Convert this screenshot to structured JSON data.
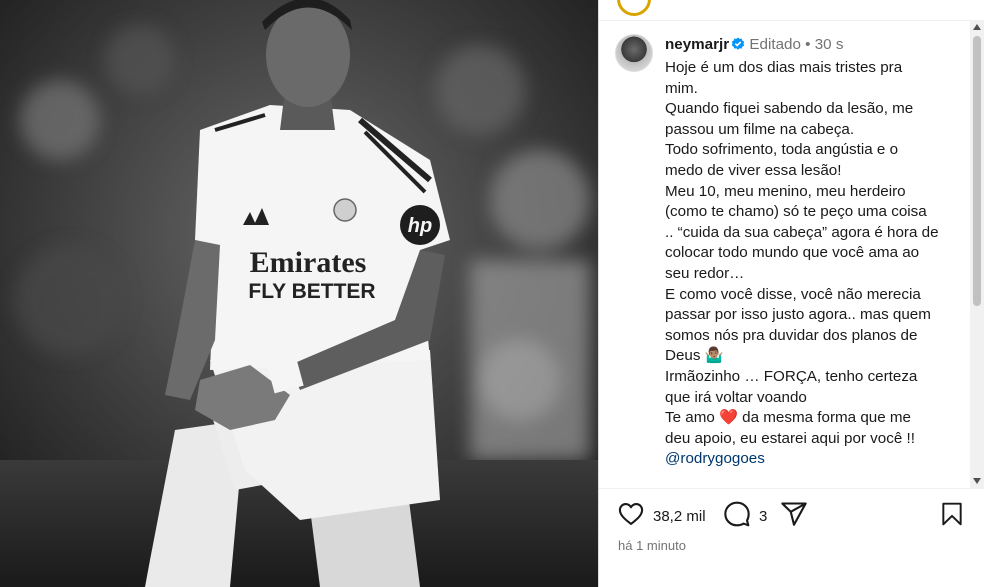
{
  "post": {
    "username": "neymarjr",
    "edited": "Editado",
    "separator": "•",
    "age": "30 s",
    "caption_lines": [
      "Hoje é um dos dias mais tristes pra",
      "mim.",
      "Quando fiquei sabendo da lesão, me",
      "passou um filme na cabeça.",
      "Todo sofrimento, toda angústia e o",
      "medo de viver essa lesão!",
      "Meu 10, meu menino, meu herdeiro",
      "(como te chamo) só te peço uma coisa",
      ".. “cuida da sua cabeça” agora é hora de",
      "colocar todo mundo que você ama ao",
      "seu redor…",
      "E como você disse, você não merecia",
      "passar por isso justo agora.. mas quem",
      "somos nós pra duvidar dos planos de",
      "Deus 🤷🏽‍♂️",
      "Irmãozinho … FORÇA, tenho certeza",
      "que irá voltar voando",
      "Te amo ❤️ da mesma forma que me",
      "deu apoio, eu estarei aqui por você !!"
    ],
    "mention": "@rodrygogoes",
    "likes": "38,2 mil",
    "comments": "3",
    "timestamp": "há 1 minuto"
  },
  "photo": {
    "jersey_sponsor": "Emirates",
    "jersey_sponsor_line2": "FLY BETTER",
    "sleeve_logo": "hp"
  },
  "icons": {
    "like": "heart-icon",
    "comment": "comment-icon",
    "share": "share-icon",
    "save": "bookmark-icon",
    "verified": "verified-badge-icon"
  },
  "colors": {
    "verified": "#0095f6",
    "mention": "#00376b",
    "meta": "#737373"
  }
}
